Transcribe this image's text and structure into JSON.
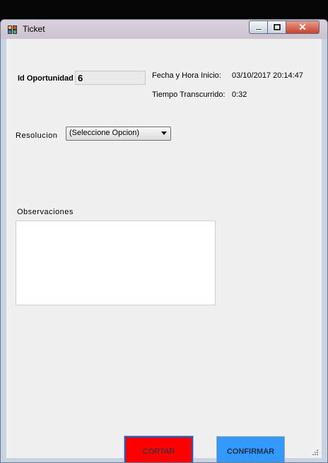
{
  "window": {
    "title": "Ticket",
    "controls": {
      "minimize": "minimize",
      "maximize": "maximize",
      "close": "✕"
    }
  },
  "form": {
    "id_oportunidad_label": "Id Oportunidad",
    "id_oportunidad_value": "6",
    "fecha_label": "Fecha y Hora Inicio:",
    "fecha_value": "03/10/2017 20:14:47",
    "tiempo_label": "Tiempo Transcurrido:",
    "tiempo_value": "0:32",
    "resolucion_label": "Resolucion",
    "resolucion_selected": "(Seleccione Opcion)",
    "observaciones_label": "Observaciones",
    "observaciones_value": ""
  },
  "buttons": {
    "cortar": "CORTAR",
    "confirmar": "CONFIRMAR"
  },
  "colors": {
    "cortar_bg": "#ff0000",
    "confirmar_bg": "#3399ff"
  }
}
